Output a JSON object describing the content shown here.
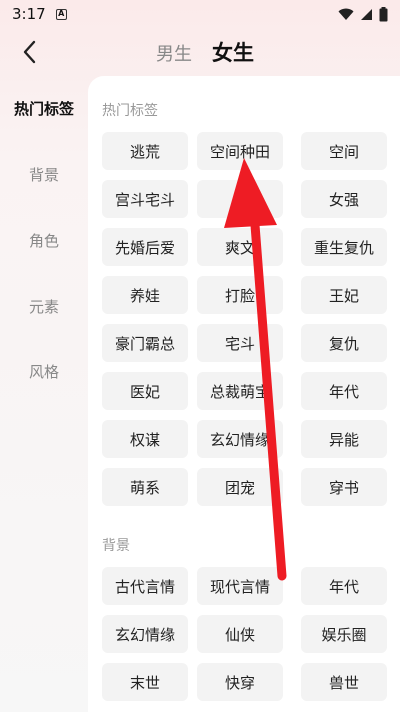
{
  "status": {
    "time": "3:17",
    "app_icon": "A"
  },
  "nav": {
    "tabs": [
      {
        "label": "男生",
        "active": false
      },
      {
        "label": "女生",
        "active": true
      }
    ]
  },
  "sidebar": {
    "items": [
      {
        "label": "热门标签",
        "active": true
      },
      {
        "label": "背景",
        "active": false
      },
      {
        "label": "角色",
        "active": false
      },
      {
        "label": "元素",
        "active": false
      },
      {
        "label": "风格",
        "active": false
      }
    ]
  },
  "sections": [
    {
      "title": "热门标签",
      "tags": [
        "逃荒",
        "空间种田",
        "空间",
        "宫斗宅斗",
        "闪",
        "女强",
        "先婚后爱",
        "爽文",
        "重生复仇",
        "养娃",
        "打脸",
        "王妃",
        "豪门霸总",
        "宅斗",
        "复仇",
        "医妃",
        "总裁萌宝",
        "年代",
        "权谋",
        "玄幻情缘",
        "异能",
        "萌系",
        "团宠",
        "穿书"
      ]
    },
    {
      "title": "背景",
      "tags": [
        "古代言情",
        "现代言情",
        "年代",
        "玄幻情缘",
        "仙侠",
        "娱乐圈",
        "末世",
        "快穿",
        "兽世"
      ]
    }
  ],
  "colors": {
    "accent_arrow": "#ee1c24",
    "tag_bg": "#f3f3f3"
  }
}
